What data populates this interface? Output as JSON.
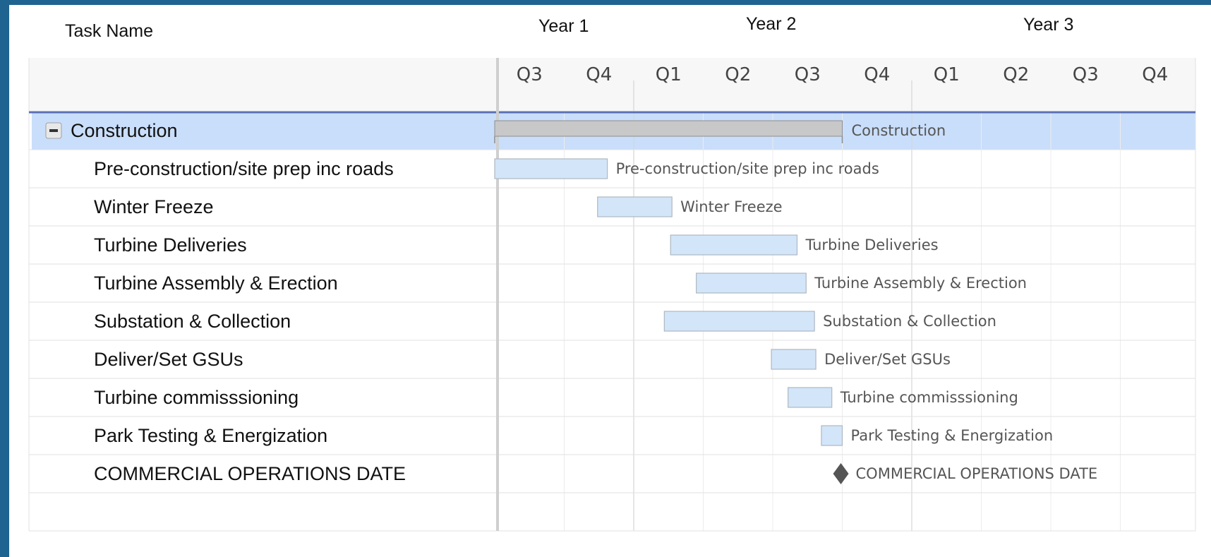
{
  "header": {
    "task_name_label": "Task Name",
    "years": [
      "Year 1",
      "Year 2",
      "Year 3"
    ]
  },
  "chart_data": {
    "type": "gantt",
    "title": "",
    "time_unit": "quarter",
    "quarters": [
      "Q3",
      "Q4",
      "Q1",
      "Q2",
      "Q3",
      "Q4",
      "Q1",
      "Q2",
      "Q3",
      "Q4"
    ],
    "tasks": [
      {
        "name": "Construction",
        "start": 0.0,
        "end": 5.0,
        "type": "summary",
        "bar_label": "Construction"
      },
      {
        "name": "Pre-construction/site prep inc roads",
        "start": 0.0,
        "end": 1.62,
        "type": "task",
        "bar_label": "Pre-construction/site prep inc roads"
      },
      {
        "name": "Winter Freeze",
        "start": 1.48,
        "end": 2.55,
        "type": "task",
        "bar_label": "Winter Freeze"
      },
      {
        "name": "Turbine Deliveries",
        "start": 2.53,
        "end": 4.35,
        "type": "task",
        "bar_label": "Turbine Deliveries"
      },
      {
        "name": "Turbine Assembly & Erection",
        "start": 2.9,
        "end": 4.48,
        "type": "task",
        "bar_label": "Turbine Assembly & Erection"
      },
      {
        "name": "Substation & Collection",
        "start": 2.44,
        "end": 4.6,
        "type": "task",
        "bar_label": "Substation & Collection"
      },
      {
        "name": "Deliver/Set GSUs",
        "start": 3.98,
        "end": 4.62,
        "type": "task",
        "bar_label": "Deliver/Set GSUs"
      },
      {
        "name": "Turbine commisssioning",
        "start": 4.22,
        "end": 4.85,
        "type": "task",
        "bar_label": "Turbine commisssioning"
      },
      {
        "name": "Park Testing & Energization",
        "start": 4.7,
        "end": 5.0,
        "type": "task",
        "bar_label": "Park Testing & Energization"
      },
      {
        "name": "COMMERCIAL OPERATIONS DATE",
        "start": 4.98,
        "end": 4.98,
        "type": "milestone",
        "bar_label": "COMMERCIAL OPERATIONS DATE"
      }
    ],
    "colors": {
      "summary_row_bg": "#c9defa",
      "summary_bar": "#c8c8c8",
      "task_bar": "#d3e5f8",
      "milestone": "#555555",
      "header_bg": "#f7f7f7",
      "header_rule": "#5a70b6"
    }
  }
}
